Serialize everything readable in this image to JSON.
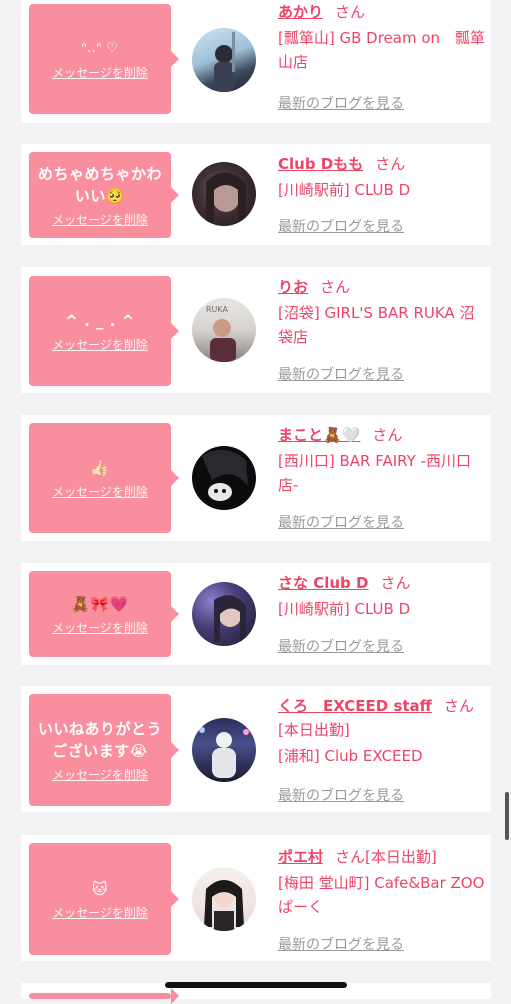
{
  "delete_label": "メッセージを削除",
  "blog_label": "最新のブログを見る",
  "san_label": "さん",
  "colors": {
    "accent": "#ee4466",
    "bubble": "#f98f9e",
    "muted": "#9a9a9a"
  },
  "items": [
    {
      "message": "ᐢ..ᐢ ♡",
      "name": "あかり",
      "status": "",
      "shop": "[瓢箪山] GB Dream on　瓢箪山店"
    },
    {
      "message": "めちゃめちゃかわいい🥺",
      "name": "Club Dもも",
      "status": "",
      "shop": "[川崎駅前] CLUB D"
    },
    {
      "message": "^ . _ . ^",
      "name": "りお",
      "status": "",
      "shop": "[沼袋] GIRL'S BAR RUKA 沼袋店"
    },
    {
      "message": "👍🏻",
      "name": "まこと🧸🤍",
      "status": "",
      "shop": "[西川口] BAR FAIRY -西川口店-"
    },
    {
      "message": "🧸🎀💗",
      "name": "さな Club D",
      "status": "",
      "shop": "[川崎駅前] CLUB D"
    },
    {
      "message": "いいねありがとうございます😭",
      "name": "くろ　EXCEED staff",
      "status": "[本日出勤]",
      "shop": "[浦和] Club EXCEED"
    },
    {
      "message": "🐱",
      "name": "ポエ村",
      "status": "[本日出勤]",
      "shop": "[梅田 堂山町] Cafe&Bar ZOOぱーく"
    }
  ]
}
